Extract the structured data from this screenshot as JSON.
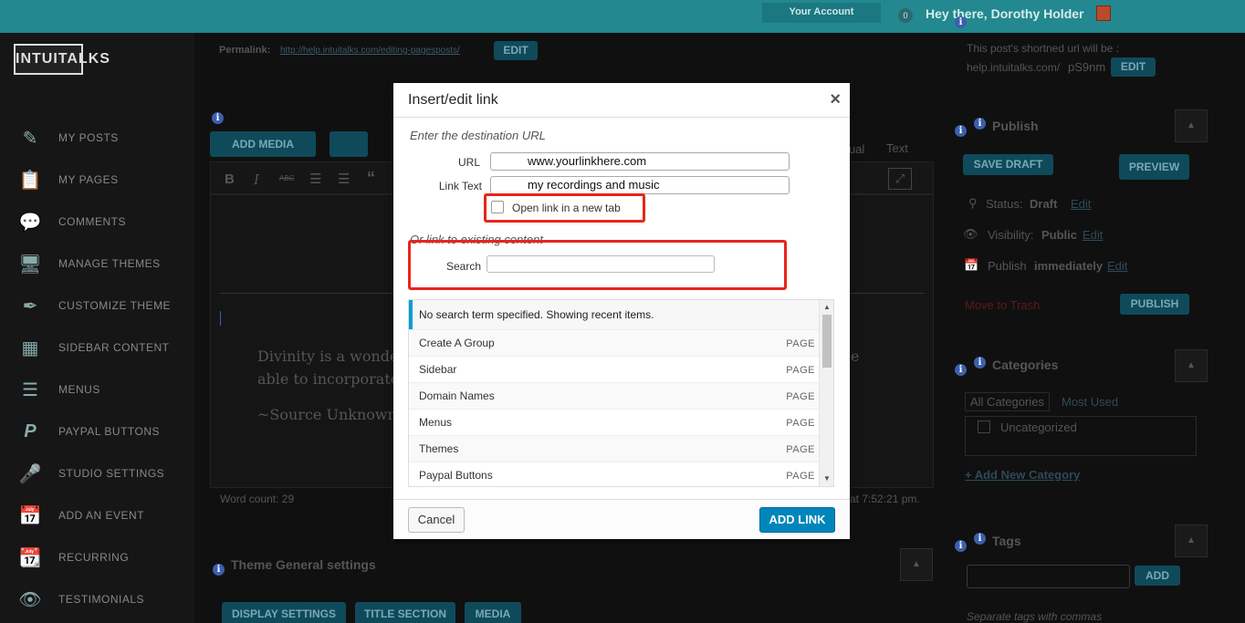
{
  "topbar": {
    "account": "Your Account",
    "badge": "0",
    "greeting": "Hey there, Dorothy Holder"
  },
  "sidebar": {
    "logo": "INTUITALKS",
    "items": [
      {
        "label": "MY POSTS",
        "icon": "pencil-note-icon"
      },
      {
        "label": "MY PAGES",
        "icon": "clipboard-icon"
      },
      {
        "label": "COMMENTS",
        "icon": "speech-bubble-icon"
      },
      {
        "label": "MANAGE THEMES",
        "icon": "monitor-icon"
      },
      {
        "label": "CUSTOMIZE THEME",
        "icon": "eyedropper-icon"
      },
      {
        "label": "SIDEBAR CONTENT",
        "icon": "calculator-icon"
      },
      {
        "label": "MENUS",
        "icon": "list-icon"
      },
      {
        "label": "PAYPAL BUTTONS",
        "icon": "paypal-icon"
      },
      {
        "label": "STUDIO SETTINGS",
        "icon": "microphone-icon"
      },
      {
        "label": "ADD AN EVENT",
        "icon": "calendar-icon"
      },
      {
        "label": "RECURRING",
        "icon": "recurring-calendar-icon"
      },
      {
        "label": "TESTIMONIALS",
        "icon": "eye-icon"
      }
    ]
  },
  "editor": {
    "permalink_label": "Permalink:",
    "permalink_url": "http://help.intuitalks.com/editing-pagesposts/",
    "edit": "EDIT",
    "add_media": "ADD MEDIA",
    "tab_visual": "ual",
    "tab_text": "Text",
    "body_line1": "Divinity is a wonderfu",
    "body_line1_tail": "e",
    "body_line2": "able to incorporate it",
    "body_line3": "~Source Unknown",
    "word_count": "Word count: 29",
    "saved_at": "at 7:52:21 pm.",
    "theme_settings": "Theme General settings",
    "tabs": [
      "DISPLAY SETTINGS",
      "TITLE SECTION",
      "MEDIA"
    ]
  },
  "right": {
    "short_url_line1": "This post's shortned url will be :",
    "short_url_host": "help.intuitalks.com/",
    "short_url_code": "pS9nm",
    "edit": "EDIT",
    "publish_title": "Publish",
    "save_draft": "SAVE DRAFT",
    "preview": "PREVIEW",
    "status_label": "Status:",
    "status_value": "Draft",
    "visibility_label": "Visibility:",
    "visibility_value": "Public",
    "publish_label": "Publish",
    "publish_value": "immediately",
    "edit_link": "Edit",
    "trash": "Move to Trash",
    "publish_btn": "PUBLISH",
    "categories_title": "Categories",
    "all_categories": "All Categories",
    "most_used": "Most Used",
    "uncategorized": "Uncategorized",
    "add_category": "+ Add New Category",
    "tags_title": "Tags",
    "add": "ADD",
    "tags_hint": "Separate tags with commas"
  },
  "modal": {
    "title": "Insert/edit link",
    "close": "×",
    "hint_url": "Enter the destination URL",
    "url_label": "URL",
    "url_value": "www.yourlinkhere.com",
    "text_label": "Link Text",
    "text_value": "my recordings and music",
    "new_tab_label": "Open link in a new tab",
    "hint_existing": "Or link to existing content",
    "search_label": "Search",
    "search_value": "",
    "results_note": "No search term specified. Showing recent items.",
    "results": [
      {
        "title": "Create A Group",
        "type": "PAGE"
      },
      {
        "title": "Sidebar",
        "type": "PAGE"
      },
      {
        "title": "Domain Names",
        "type": "PAGE"
      },
      {
        "title": "Menus",
        "type": "PAGE"
      },
      {
        "title": "Themes",
        "type": "PAGE"
      },
      {
        "title": "Paypal Buttons",
        "type": "PAGE"
      }
    ],
    "cancel": "Cancel",
    "add_link": "ADD LINK"
  },
  "colors": {
    "topbar": "#23888f",
    "accent": "#0085ba",
    "highlight": "#e8251a"
  }
}
